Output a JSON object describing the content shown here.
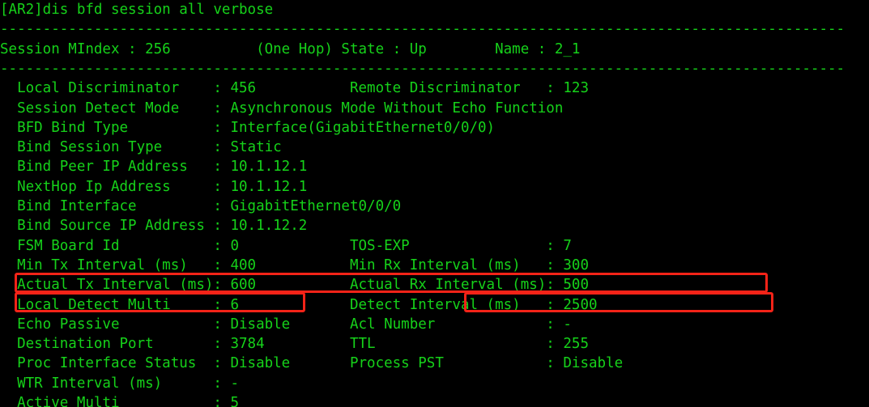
{
  "terminal": {
    "prompt": "[AR2]",
    "command": "dis bfd session all verbose",
    "command_line": "[AR2]dis bfd session all verbose",
    "separator": "---------------------------------------------------------------------------------------------------",
    "session_header": "Session MIndex : 256          (One Hop) State : Up        Name : 2_1",
    "colors": {
      "background": "#000000",
      "text": "#16d21a",
      "highlight": "#f42318"
    },
    "lines": [
      "  Local Discriminator    : 456           Remote Discriminator   : 123",
      "  Session Detect Mode    : Asynchronous Mode Without Echo Function",
      "  BFD Bind Type          : Interface(GigabitEthernet0/0/0)",
      "  Bind Session Type      : Static",
      "  Bind Peer IP Address   : 10.1.12.1",
      "  NextHop Ip Address     : 10.1.12.1",
      "  Bind Interface         : GigabitEthernet0/0/0",
      "  Bind Source IP Address : 10.1.12.2",
      "  FSM Board Id           : 0             TOS-EXP                : 7",
      "  Min Tx Interval (ms)   : 400           Min Rx Interval (ms)   : 300",
      "  Actual Tx Interval (ms): 600           Actual Rx Interval (ms): 500",
      "  Local Detect Multi     : 6             Detect Interval (ms)   : 2500",
      "  Echo Passive           : Disable       Acl Number             : -",
      "  Destination Port       : 3784          TTL                    : 255",
      "  Proc Interface Status  : Disable       Process PST            : Disable",
      "  WTR Interval (ms)      : -",
      "  Active Multi           : 5"
    ],
    "fields": [
      {
        "label": "Local Discriminator",
        "value": "456",
        "label2": "Remote Discriminator",
        "value2": "123"
      },
      {
        "label": "Session Detect Mode",
        "value": "Asynchronous Mode Without Echo Function",
        "label2": "",
        "value2": ""
      },
      {
        "label": "BFD Bind Type",
        "value": "Interface(GigabitEthernet0/0/0)",
        "label2": "",
        "value2": ""
      },
      {
        "label": "Bind Session Type",
        "value": "Static",
        "label2": "",
        "value2": ""
      },
      {
        "label": "Bind Peer IP Address",
        "value": "10.1.12.1",
        "label2": "",
        "value2": ""
      },
      {
        "label": "NextHop Ip Address",
        "value": "10.1.12.1",
        "label2": "",
        "value2": ""
      },
      {
        "label": "Bind Interface",
        "value": "GigabitEthernet0/0/0",
        "label2": "",
        "value2": ""
      },
      {
        "label": "Bind Source IP Address",
        "value": "10.1.12.2",
        "label2": "",
        "value2": ""
      },
      {
        "label": "FSM Board Id",
        "value": "0",
        "label2": "TOS-EXP",
        "value2": "7"
      },
      {
        "label": "Min Tx Interval (ms)",
        "value": "400",
        "label2": "Min Rx Interval (ms)",
        "value2": "300"
      },
      {
        "label": "Actual Tx Interval (ms)",
        "value": "600",
        "label2": "Actual Rx Interval (ms)",
        "value2": "500"
      },
      {
        "label": "Local Detect Multi",
        "value": "6",
        "label2": "Detect Interval (ms)",
        "value2": "2500"
      },
      {
        "label": "Echo Passive",
        "value": "Disable",
        "label2": "Acl Number",
        "value2": "-"
      },
      {
        "label": "Destination Port",
        "value": "3784",
        "label2": "TTL",
        "value2": "255"
      },
      {
        "label": "Proc Interface Status",
        "value": "Disable",
        "label2": "Process PST",
        "value2": "Disable"
      },
      {
        "label": "WTR Interval (ms)",
        "value": "-",
        "label2": "",
        "value2": ""
      },
      {
        "label": "Active Multi",
        "value": "5",
        "label2": "",
        "value2": ""
      }
    ],
    "session_info": {
      "mindex_label": "Session MIndex",
      "mindex_value": "256",
      "hop_mode": "(One Hop)",
      "state_label": "State",
      "state_value": "Up",
      "name_label": "Name",
      "name_value": "2_1"
    },
    "annotations": [
      {
        "id": "actual-intervals",
        "note": "Actual Tx Interval (ms): 600 / Actual Rx Interval (ms): 500"
      },
      {
        "id": "local-detect-multi",
        "note": "Local Detect Multi : 6"
      },
      {
        "id": "detect-interval",
        "note": "Detect Interval (ms) : 2500"
      }
    ]
  }
}
